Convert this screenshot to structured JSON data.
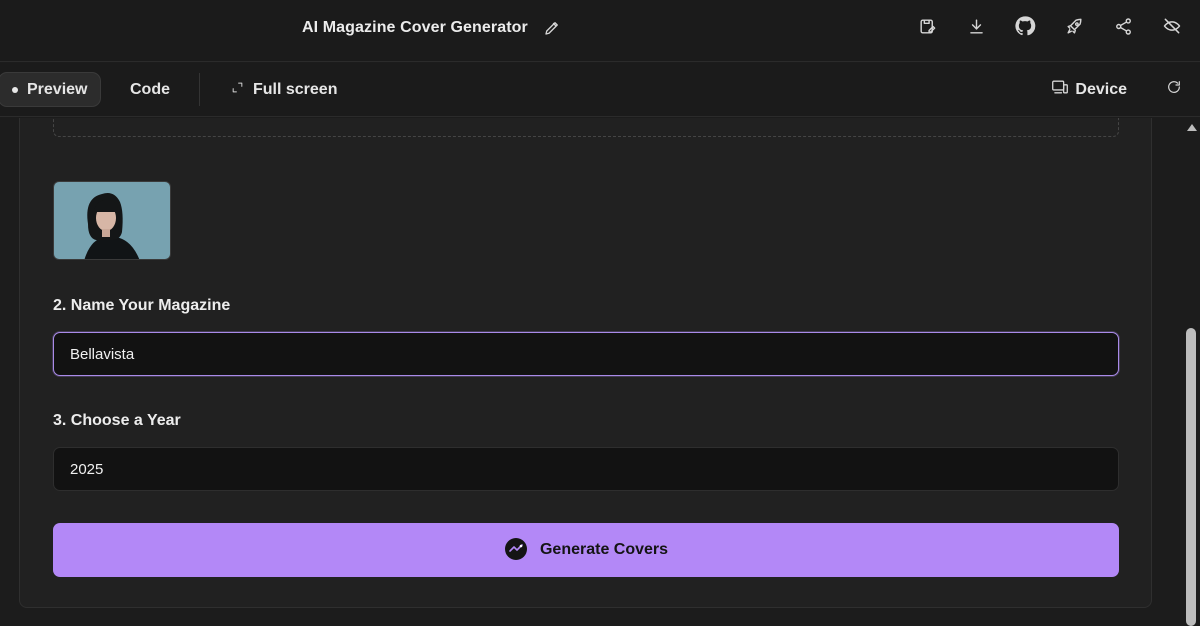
{
  "header": {
    "title": "AI Magazine Cover Generator",
    "edit_icon": "pencil-icon",
    "actions": [
      {
        "icon": "save-icon"
      },
      {
        "icon": "download-icon"
      },
      {
        "icon": "github-icon"
      },
      {
        "icon": "rocket-icon"
      },
      {
        "icon": "share-icon"
      },
      {
        "icon": "eye-off-icon"
      }
    ]
  },
  "tabs": {
    "preview": "Preview",
    "code": "Code",
    "fullscreen": "Full screen",
    "device": "Device"
  },
  "form": {
    "upload_hint": "",
    "name_label": "2. Name Your Magazine",
    "name_value": "Bellavista",
    "year_label": "3. Choose a Year",
    "year_value": "2025",
    "generate_label": "Generate Covers"
  },
  "colors": {
    "accent": "#b388f7",
    "focus_border": "#a98ae8",
    "background": "#1c1c1c",
    "card": "#212121"
  }
}
